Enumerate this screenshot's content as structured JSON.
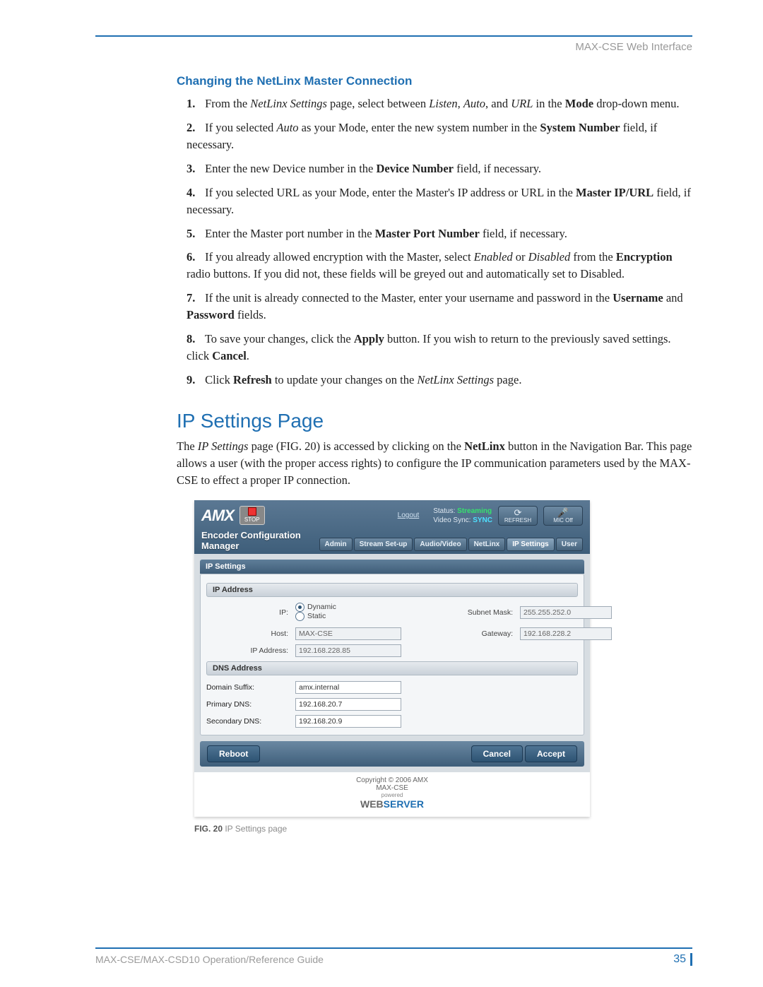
{
  "header": {
    "right": "MAX-CSE Web Interface"
  },
  "section1": {
    "title": "Changing the NetLinx Master Connection",
    "steps": [
      {
        "pre": "From the ",
        "i1": "NetLinx Settings",
        "mid1": " page, select between ",
        "i2": "Listen",
        "mid2": ", ",
        "i3": "Auto",
        "mid3": ", and ",
        "i4": "URL",
        "mid4": " in the ",
        "b1": "Mode",
        "post": " drop-down menu."
      },
      {
        "pre": "If you selected ",
        "i1": "Auto",
        "mid1": " as your Mode, enter the new system number in the ",
        "b1": "System Number",
        "post": " field, if necessary."
      },
      {
        "pre": "Enter the new Device number in the ",
        "b1": "Device Number",
        "post": " field, if necessary."
      },
      {
        "pre": "If you selected URL as your Mode, enter the Master's IP address or URL in the ",
        "b1": "Master IP/URL",
        "post": " field, if necessary."
      },
      {
        "pre": "Enter the Master port number in the ",
        "b1": "Master Port Number",
        "post": " field, if necessary."
      },
      {
        "pre": "If you already allowed encryption with the Master, select ",
        "i1": "Enabled",
        "mid1": " or ",
        "i2": "Disabled",
        "mid2": " from the ",
        "b1": "Encryption",
        "post": " radio buttons. If you did not, these fields will be greyed out and automatically set to Disabled."
      },
      {
        "pre": "If the unit is already connected to the Master, enter your username and password in the ",
        "b1": "Username",
        "mid1": " and ",
        "b2": "Password",
        "post": " fields."
      },
      {
        "pre": "To save your changes, click the ",
        "b1": "Apply",
        "mid1": " button. If you wish to return to the previously saved settings. click ",
        "b2": "Cancel",
        "post": "."
      },
      {
        "pre": "Click ",
        "b1": "Refresh",
        "mid1": " to update your changes on the ",
        "i1": "NetLinx Settings",
        "post": " page."
      }
    ]
  },
  "section2": {
    "title": "IP Settings Page",
    "para_pre": "The ",
    "para_i1": "IP Settings",
    "para_mid1": " page (FIG. 20) is accessed by clicking on the ",
    "para_b1": "NetLinx",
    "para_post": " button in the Navigation Bar. This page allows a user (with the proper access rights) to configure the IP communication parameters used by the MAX-CSE to effect a proper IP connection."
  },
  "shot": {
    "logo": "AMX",
    "stop": "STOP",
    "logout": "Logout",
    "status_label": "Status:",
    "status_value": "Streaming",
    "vsync_label": "Video Sync:",
    "vsync_value": "SYNC",
    "refresh_btn": "REFRESH",
    "mic_btn": "MIC Off",
    "ecm": "Encoder Configuration Manager",
    "tabs": [
      "Admin",
      "Stream Set-up",
      "Audio/Video",
      "NetLinx",
      "IP Settings",
      "User"
    ],
    "active_tab_index": 4,
    "panel_title": "IP Settings",
    "ipaddr_head": "IP Address",
    "ip_label": "IP:",
    "ip_dynamic": "Dynamic",
    "ip_static": "Static",
    "host_label": "Host:",
    "host_value": "MAX-CSE",
    "ipaddress_label": "IP Address:",
    "ipaddress_value": "192.168.228.85",
    "subnet_label": "Subnet Mask:",
    "subnet_value": "255.255.252.0",
    "gateway_label": "Gateway:",
    "gateway_value": "192.168.228.2",
    "dns_head": "DNS Address",
    "domain_suffix_label": "Domain Suffix:",
    "domain_suffix_value": "amx.internal",
    "primary_dns_label": "Primary DNS:",
    "primary_dns_value": "192.168.20.7",
    "secondary_dns_label": "Secondary DNS:",
    "secondary_dns_value": "192.168.20.9",
    "reboot": "Reboot",
    "cancel": "Cancel",
    "accept": "Accept",
    "copyright": "Copyright © 2006 AMX",
    "device": "MAX-CSE",
    "powered": "powered",
    "webserver_a": "WEB",
    "webserver_b": "SERVER"
  },
  "figure": {
    "num": "FIG. 20",
    "caption": " IP Settings page"
  },
  "footer": {
    "left": "MAX-CSE/MAX-CSD10 Operation/Reference Guide",
    "page": "35"
  }
}
